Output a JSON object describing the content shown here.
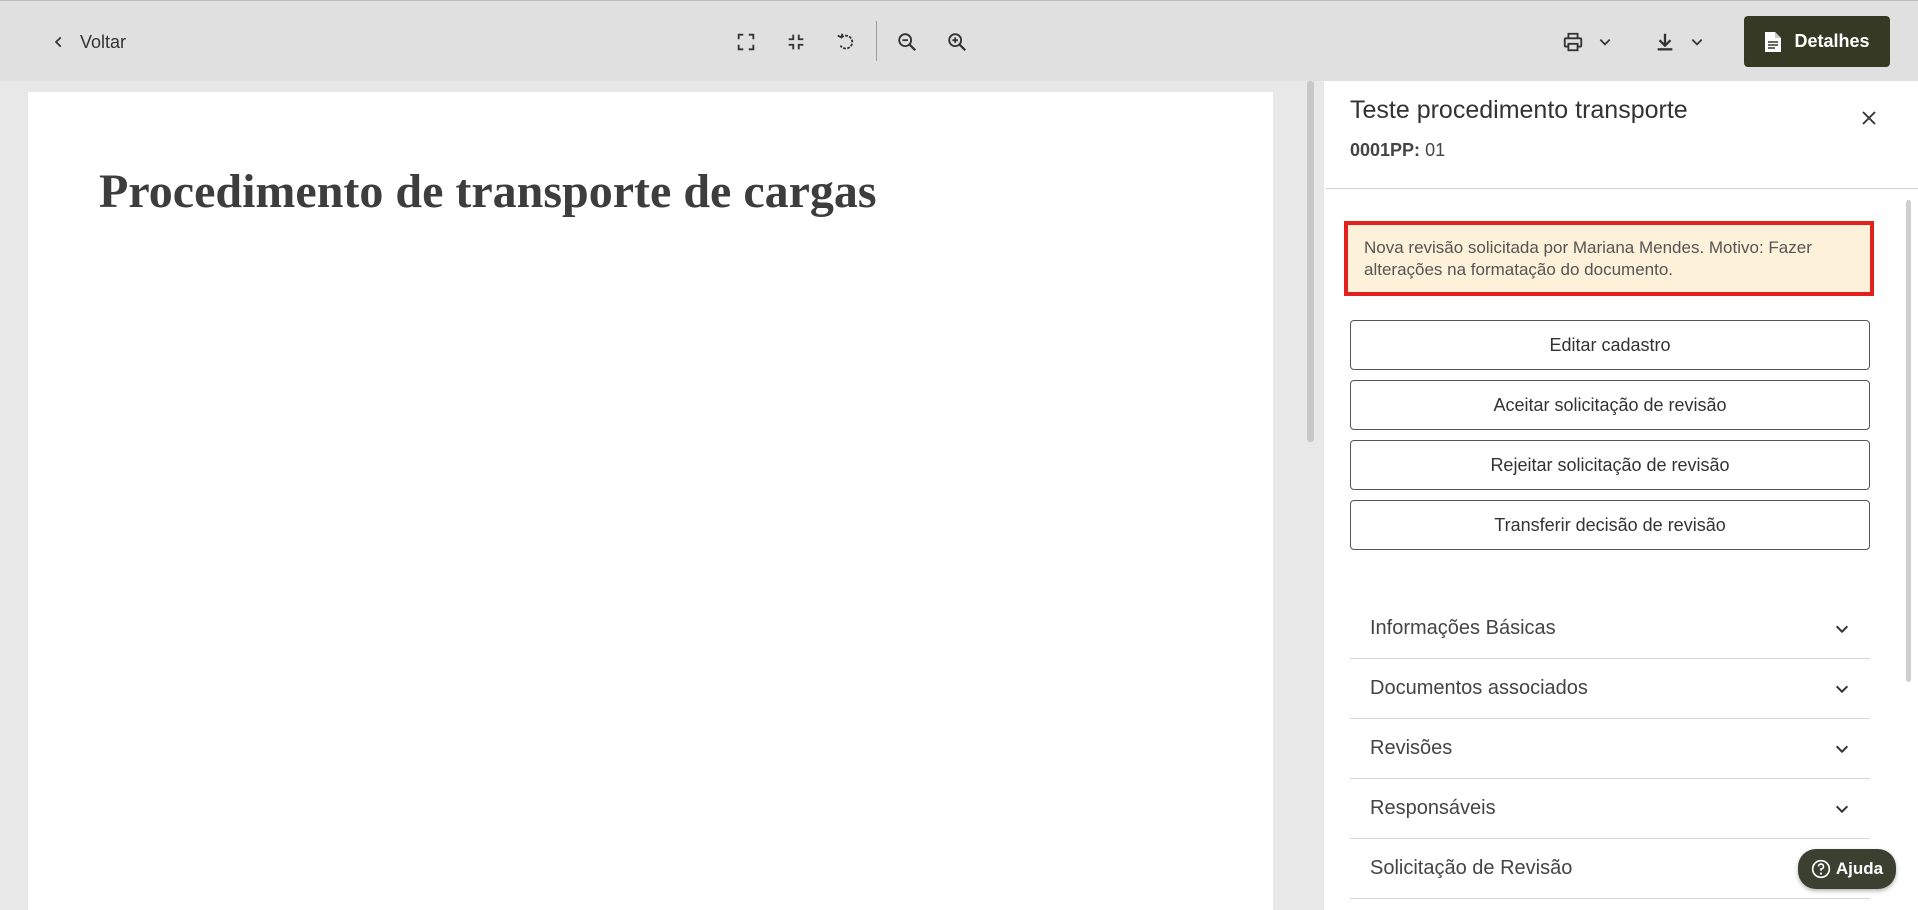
{
  "toolbar": {
    "back_label": "Voltar",
    "details_label": "Detalhes",
    "icons": [
      "fullscreen-icon",
      "exit-fullscreen-icon",
      "rotate-icon",
      "zoom-out-icon",
      "zoom-in-icon",
      "print-icon",
      "download-icon"
    ]
  },
  "document": {
    "title": "Procedimento de transporte de cargas"
  },
  "panel": {
    "title": "Teste procedimento transporte",
    "code_label": "0001PP:",
    "code_value": "01",
    "notice": "Nova revisão solicitada por Mariana Mendes. Motivo: Fazer alterações na formatação do documento.",
    "actions": [
      "Editar cadastro",
      "Aceitar solicitação de revisão",
      "Rejeitar solicitação de revisão",
      "Transferir decisão de revisão"
    ],
    "sections": [
      "Informações Básicas",
      "Documentos associados",
      "Revisões",
      "Responsáveis",
      "Solicitação de Revisão"
    ]
  },
  "help_label": "Ajuda",
  "colors": {
    "accent_dark": "#363a25",
    "notice_border": "#e2211c",
    "notice_bg": "#fdf1d9"
  }
}
